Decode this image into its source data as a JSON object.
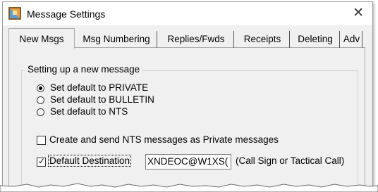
{
  "window": {
    "title": "Message Settings",
    "close_glyph": "✕",
    "app_icon": "mail-settings-icon"
  },
  "tabs": [
    {
      "label": "New Msgs",
      "active": true
    },
    {
      "label": "Msg Numbering",
      "active": false
    },
    {
      "label": "Replies/Fwds",
      "active": false
    },
    {
      "label": "Receipts",
      "active": false
    },
    {
      "label": "Deleting",
      "active": false
    },
    {
      "label": "Adv",
      "active": false
    }
  ],
  "group": {
    "label": "Setting up a new message",
    "radios": [
      {
        "label": "Set default to PRIVATE",
        "checked": true
      },
      {
        "label": "Set default to BULLETIN",
        "checked": false
      },
      {
        "label": "Set default to NTS",
        "checked": false
      }
    ],
    "nts_private": {
      "label": "Create and send NTS messages as Private messages",
      "checked": false
    },
    "default_destination": {
      "label": "Default Destination",
      "checked": true,
      "value": "XNDEOC@W1XS(",
      "hint": "(Call Sign or Tactical Call)"
    }
  },
  "check_glyph": "✓"
}
